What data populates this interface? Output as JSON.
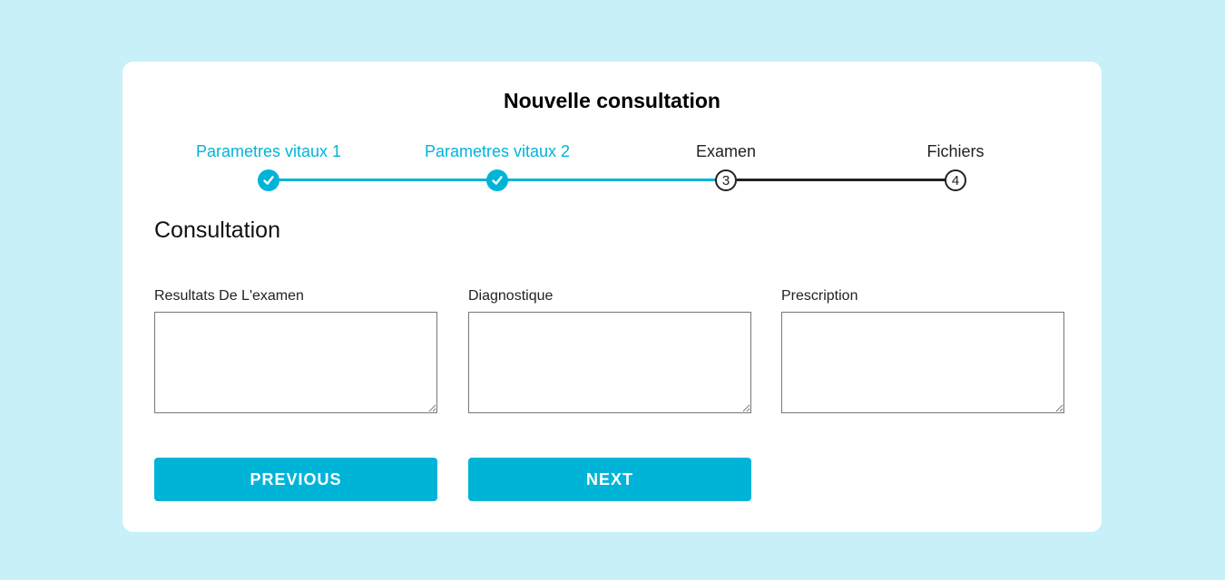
{
  "form": {
    "title": "Nouvelle consultation",
    "section_title": "Consultation"
  },
  "stepper": {
    "steps": [
      {
        "label": "Parametres vitaux 1",
        "status": "completed",
        "number": "1"
      },
      {
        "label": "Parametres vitaux 2",
        "status": "completed",
        "number": "2"
      },
      {
        "label": "Examen",
        "status": "active",
        "number": "3"
      },
      {
        "label": "Fichiers",
        "status": "pending",
        "number": "4"
      }
    ]
  },
  "fields": [
    {
      "label": "Resultats De L'examen",
      "value": "",
      "placeholder": ""
    },
    {
      "label": "Diagnostique",
      "value": "",
      "placeholder": ""
    },
    {
      "label": "Prescription",
      "value": "",
      "placeholder": ""
    }
  ],
  "buttons": {
    "previous_label": "PREVIOUS",
    "next_label": "NEXT"
  },
  "colors": {
    "background": "#c8f0f8",
    "accent": "#00b4d8",
    "card": "#ffffff",
    "pending": "#222222"
  },
  "icons": {
    "completed_step": "check-icon"
  }
}
